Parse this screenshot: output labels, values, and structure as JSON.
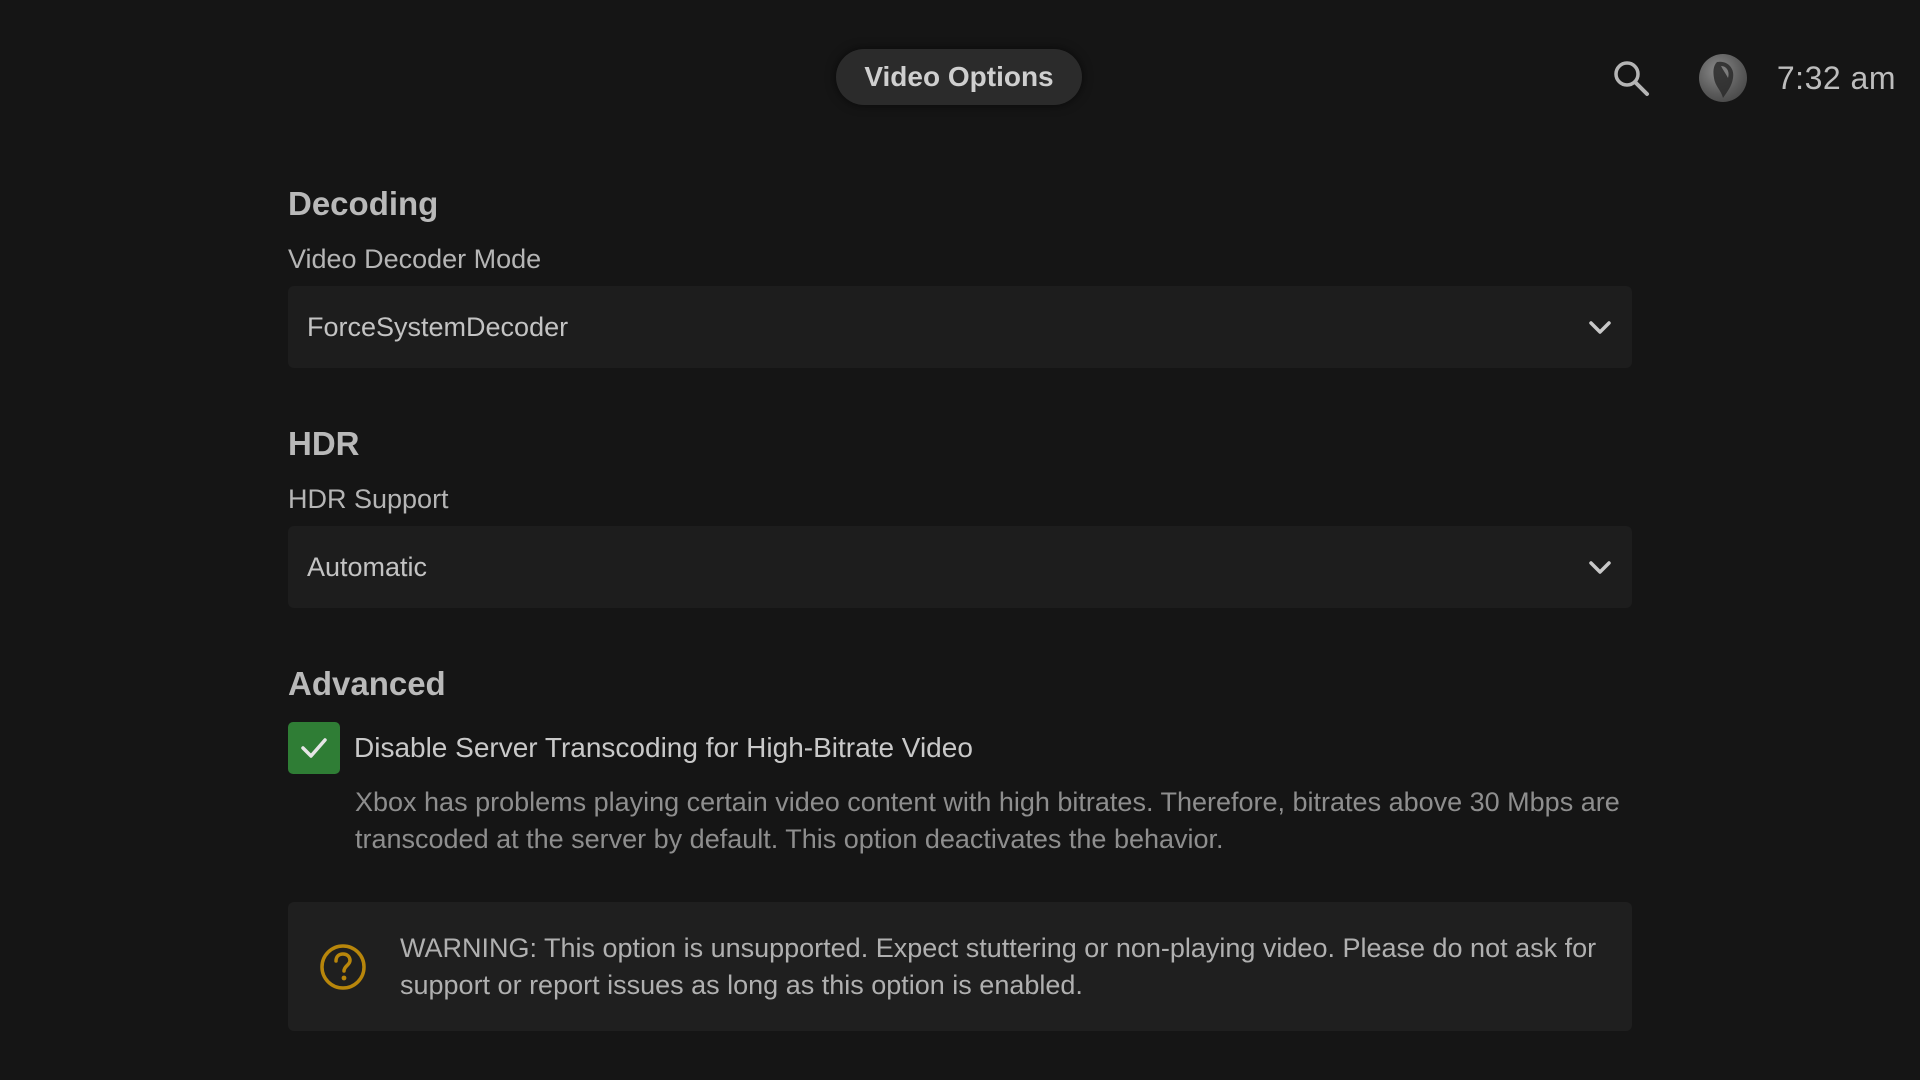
{
  "header": {
    "title": "Video Options",
    "clock": "7:32 am"
  },
  "icons": {
    "search": "search-icon",
    "avatar": "avatar",
    "chevron": "chevron-down-icon",
    "check": "checkmark-icon",
    "warning": "question-circle-icon"
  },
  "colors": {
    "background": "#151515",
    "checkbox_checked": "#2f7d35",
    "warning_icon": "#b8860b"
  },
  "sections": {
    "decoding": {
      "title": "Decoding",
      "video_decoder_label": "Video Decoder Mode",
      "video_decoder_value": "ForceSystemDecoder"
    },
    "hdr": {
      "title": "HDR",
      "hdr_support_label": "HDR Support",
      "hdr_support_value": "Automatic"
    },
    "advanced": {
      "title": "Advanced",
      "checkbox_label": "Disable Server Transcoding for High-Bitrate Video",
      "checkbox_checked": true,
      "checkbox_description": "Xbox has problems playing certain video content with high bitrates. Therefore, bitrates above 30 Mbps are transcoded at the server by default. This option deactivates the behavior.",
      "warning": "WARNING: This option is unsupported. Expect stuttering or non-playing video. Please do not ask for support or report issues as long as this option is enabled."
    }
  }
}
